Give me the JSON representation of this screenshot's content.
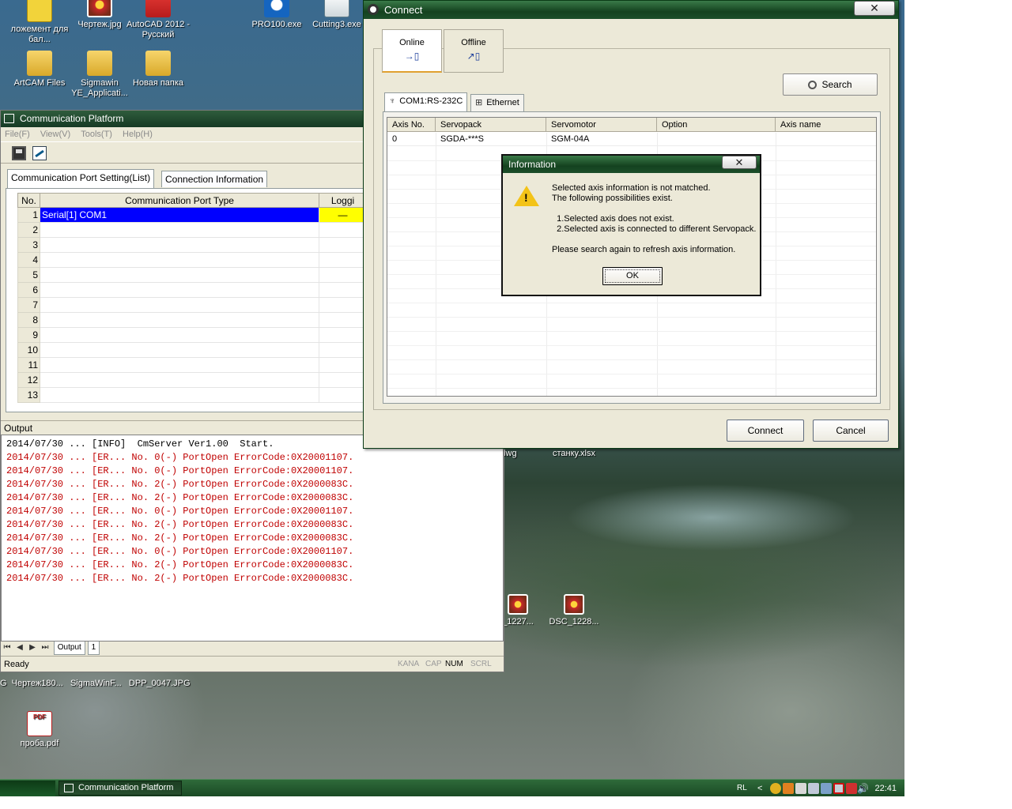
{
  "desktop": {
    "icons": [
      {
        "label": "ложемент для бал...",
        "kind": "dwg"
      },
      {
        "label": "Чертеж.jpg",
        "kind": "jpg"
      },
      {
        "label": "AutoCAD 2012 - Русский",
        "kind": "cad"
      },
      {
        "label": "PRO100.exe",
        "kind": "exe"
      },
      {
        "label": "Cutting3.exe",
        "kind": "exe2"
      },
      {
        "label": "ArtCAM Files",
        "kind": "folder"
      },
      {
        "label": "Sigmawin YE_Applicati...",
        "kind": "folder"
      },
      {
        "label": "Новая папка",
        "kind": "folder"
      },
      {
        "label": "проба.pdf",
        "kind": "pdf"
      },
      {
        "label": ".dwg",
        "kind": "dwg"
      },
      {
        "label": "станку.xlsx",
        "kind": "xlsx"
      },
      {
        "label": "_1227...",
        "kind": "jpg"
      },
      {
        "label": "DSC_1228...",
        "kind": "jpg"
      }
    ],
    "strip_labels": "G  Чертеж180...   SigmaWinF...   DPP_0047.JPG"
  },
  "cp": {
    "title": "Communication Platform",
    "menu": [
      "File(F)",
      "View(V)",
      "Tools(T)",
      "Help(H)"
    ],
    "tabs": [
      "Communication Port Setting(List)",
      "Connection Information"
    ],
    "columns": [
      "No.",
      "Communication Port Type",
      "Loggi"
    ],
    "rows": [
      {
        "no": "1",
        "type": "Serial[1] COM1",
        "log": "—"
      },
      {
        "no": "2",
        "type": "",
        "log": ""
      },
      {
        "no": "3",
        "type": "",
        "log": ""
      },
      {
        "no": "4",
        "type": "",
        "log": ""
      },
      {
        "no": "5",
        "type": "",
        "log": ""
      },
      {
        "no": "6",
        "type": "",
        "log": ""
      },
      {
        "no": "7",
        "type": "",
        "log": ""
      },
      {
        "no": "8",
        "type": "",
        "log": ""
      },
      {
        "no": "9",
        "type": "",
        "log": ""
      },
      {
        "no": "10",
        "type": "",
        "log": ""
      },
      {
        "no": "11",
        "type": "",
        "log": ""
      },
      {
        "no": "12",
        "type": "",
        "log": ""
      },
      {
        "no": "13",
        "type": "",
        "log": ""
      }
    ],
    "output_label": "Output",
    "output_lines": [
      {
        "text": "2014/07/30 ... [INFO]  CmServer Ver1.00  Start.",
        "level": "info"
      },
      {
        "text": "2014/07/30 ... [ER... No. 0(-) PortOpen ErrorCode:0X20001107.",
        "level": "err"
      },
      {
        "text": "2014/07/30 ... [ER... No. 0(-) PortOpen ErrorCode:0X20001107.",
        "level": "err"
      },
      {
        "text": "2014/07/30 ... [ER... No. 2(-) PortOpen ErrorCode:0X2000083C.",
        "level": "err"
      },
      {
        "text": "2014/07/30 ... [ER... No. 2(-) PortOpen ErrorCode:0X2000083C.",
        "level": "err"
      },
      {
        "text": "2014/07/30 ... [ER... No. 0(-) PortOpen ErrorCode:0X20001107.",
        "level": "err"
      },
      {
        "text": "2014/07/30 ... [ER... No. 2(-) PortOpen ErrorCode:0X2000083C.",
        "level": "err"
      },
      {
        "text": "2014/07/30 ... [ER... No. 2(-) PortOpen ErrorCode:0X2000083C.",
        "level": "err"
      },
      {
        "text": "2014/07/30 ... [ER... No. 0(-) PortOpen ErrorCode:0X20001107.",
        "level": "err"
      },
      {
        "text": "2014/07/30 ... [ER... No. 2(-) PortOpen ErrorCode:0X2000083C.",
        "level": "err"
      },
      {
        "text": "2014/07/30 ... [ER... No. 2(-) PortOpen ErrorCode:0X2000083C.",
        "level": "err"
      }
    ],
    "output_tabs": [
      "Output",
      "1"
    ],
    "status": "Ready",
    "indicators": [
      "KANA",
      "CAP",
      "NUM",
      "SCRL"
    ]
  },
  "connect": {
    "title": "Connect",
    "close_glyph": "✕",
    "mode_tabs": [
      {
        "label": "Online",
        "glyph": "→▯"
      },
      {
        "label": "Offline",
        "glyph": "↗▯"
      }
    ],
    "search_label": "Search",
    "sub_tabs": [
      {
        "label": "COM1:RS-232C",
        "glyph": "♆"
      },
      {
        "label": "Ethernet",
        "glyph": "⊞"
      }
    ],
    "columns": [
      "Axis No.",
      "Servopack",
      "Servomotor",
      "Option",
      "Axis name"
    ],
    "rows": [
      {
        "axis_no": "0",
        "servopack": "SGDA-***S",
        "servomotor": "SGM-04A",
        "option": "",
        "axis_name": ""
      }
    ],
    "connect_label": "Connect",
    "cancel_label": "Cancel"
  },
  "info": {
    "title": "Information",
    "close_glyph": "✕",
    "message": "Selected axis information is not matched.\nThe following possibilities exist.\n\n  1.Selected axis does not exist.\n  2.Selected axis is connected to different Servopack.\n\nPlease search again to refresh axis information.",
    "ok_label": "OK"
  },
  "taskbar": {
    "task_label": "Communication Platform",
    "lang": "RL",
    "tray_arrow": "<",
    "time": "22:41"
  }
}
